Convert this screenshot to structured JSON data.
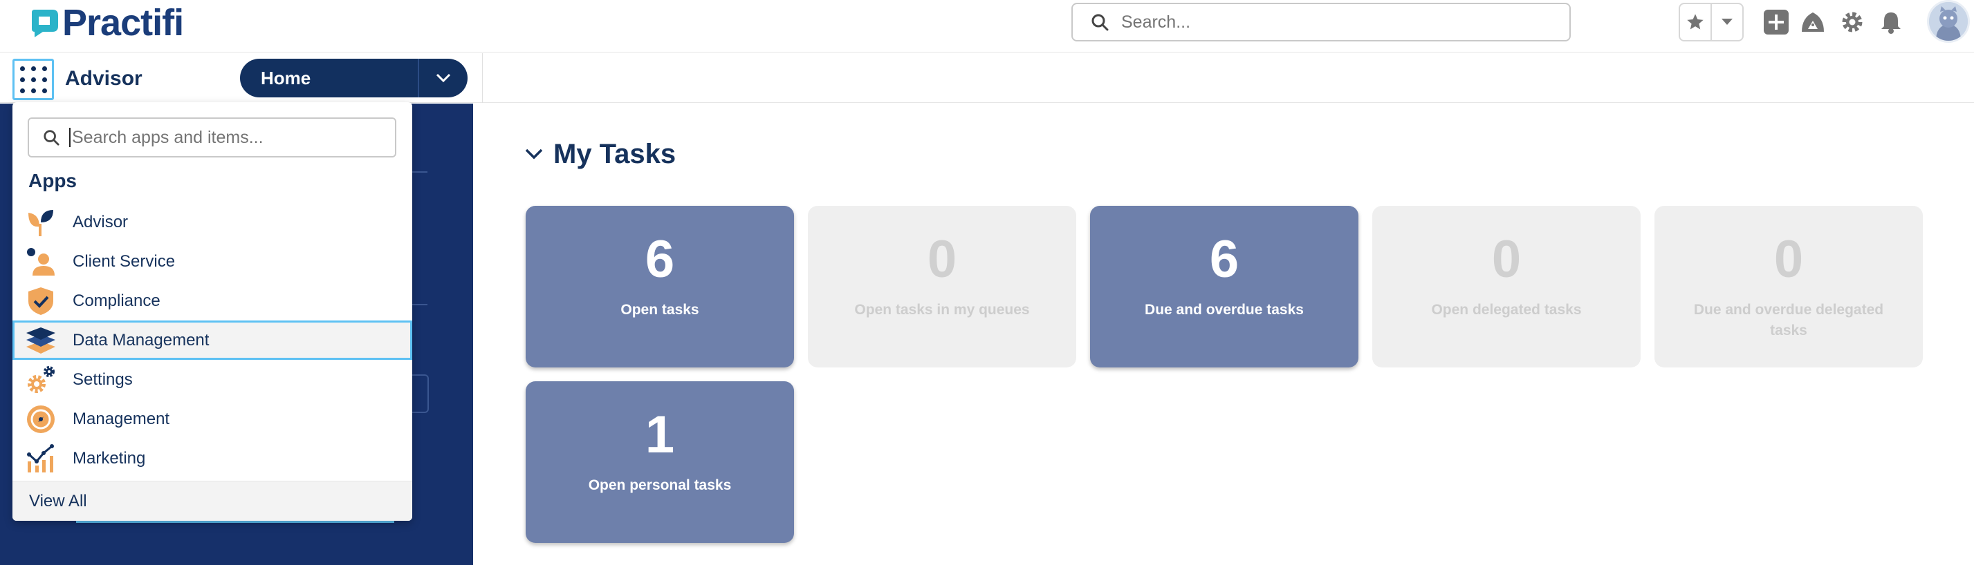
{
  "header": {
    "brand": "Practifi",
    "search_placeholder": "Search...",
    "colors": {
      "brand_blue": "#1b3d7a",
      "brand_teal": "#2bb3c9"
    },
    "icons": [
      "star-icon",
      "chevron-down-icon",
      "add-icon",
      "trailhead-icon",
      "gear-icon",
      "bell-icon",
      "avatar"
    ]
  },
  "navbar": {
    "app_name": "Advisor",
    "home_label": "Home"
  },
  "launcher_menu": {
    "search_placeholder": "Search apps and items...",
    "heading": "Apps",
    "items": [
      {
        "label": "Advisor",
        "icon": "advisor-icon"
      },
      {
        "label": "Client Service",
        "icon": "client-service-icon"
      },
      {
        "label": "Compliance",
        "icon": "compliance-shield-icon"
      },
      {
        "label": "Data Management",
        "icon": "data-management-layers-icon",
        "selected": true
      },
      {
        "label": "Settings",
        "icon": "settings-gears-icon"
      },
      {
        "label": "Management",
        "icon": "management-compass-icon"
      },
      {
        "label": "Marketing",
        "icon": "marketing-chart-icon"
      }
    ],
    "view_all": "View All"
  },
  "main": {
    "section_title": "My Tasks",
    "tiles": [
      {
        "count": "6",
        "label": "Open tasks",
        "active": true
      },
      {
        "count": "0",
        "label": "Open tasks in my queues",
        "active": false
      },
      {
        "count": "6",
        "label": "Due and overdue tasks",
        "active": true
      },
      {
        "count": "0",
        "label": "Open delegated tasks",
        "active": false
      },
      {
        "count": "0",
        "label": "Due and overdue delegated tasks",
        "active": false
      },
      {
        "count": "1",
        "label": "Open personal tasks",
        "active": true
      }
    ],
    "colors": {
      "tile_active": "#6e80ab",
      "tile_inactive": "#efefef",
      "title": "#16325c"
    }
  }
}
